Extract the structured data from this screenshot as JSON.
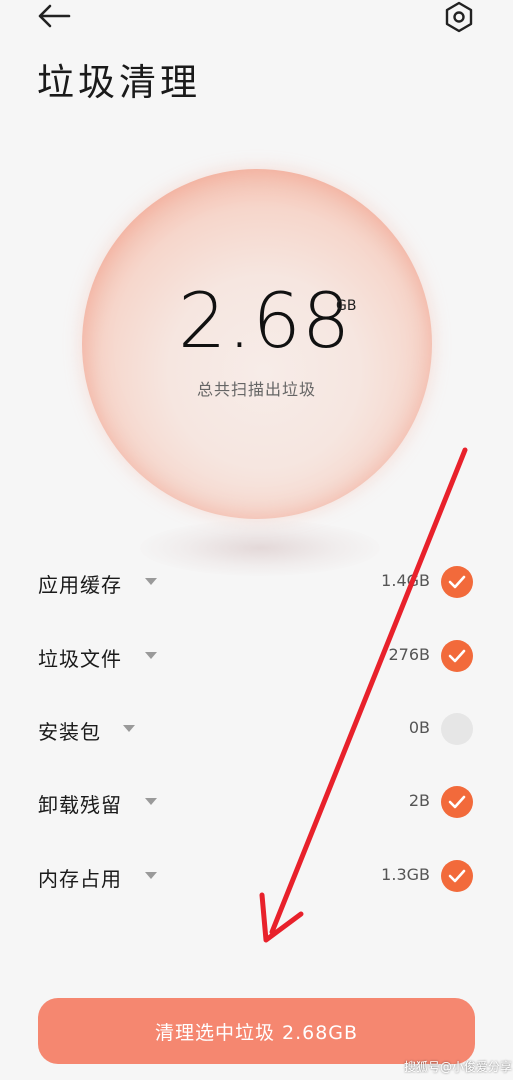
{
  "header": {
    "title": "垃圾清理"
  },
  "summary": {
    "value": "2.68",
    "unit": "GB",
    "caption": "总共扫描出垃圾"
  },
  "items": [
    {
      "label": "应用缓存",
      "size": "1.4GB",
      "checked": true
    },
    {
      "label": "垃圾文件",
      "size": "276B",
      "checked": true
    },
    {
      "label": "安装包",
      "size": "0B",
      "checked": false
    },
    {
      "label": "卸载残留",
      "size": "2B",
      "checked": true
    },
    {
      "label": "内存占用",
      "size": "1.3GB",
      "checked": true
    }
  ],
  "action": {
    "label": "清理选中垃圾 2.68GB"
  },
  "watermark": "搜狐号@小俊爱分享",
  "colors": {
    "accent": "#f26a3b",
    "button": "#f58770",
    "annotation": "#e8212b"
  },
  "icons": {
    "back": "arrow-left-icon",
    "settings": "hexagon-gear-icon",
    "check": "checkmark-icon",
    "dropdown": "caret-down-icon"
  }
}
